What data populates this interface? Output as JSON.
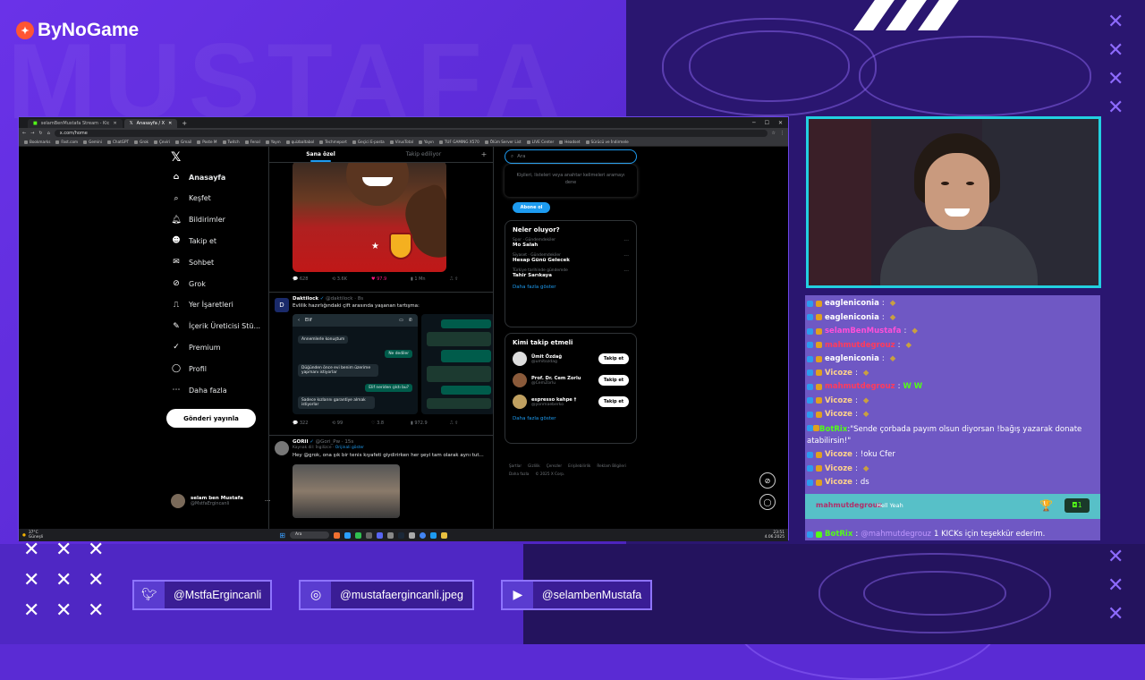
{
  "brand": {
    "logo": "ByNoGame"
  },
  "browser": {
    "tabs": [
      "selamBenMustafa Stream - Kic",
      "Anasayfa / X"
    ],
    "url": "x.com/home",
    "bookmarks": [
      "Bookmarks",
      "Fast.com",
      "Gemini",
      "ChatGPT",
      "Grok",
      "Çeviri",
      "Gmail",
      "Poste M",
      "Twitch",
      "Fenal",
      "Yayın",
      "quizbaltabol",
      "Techmeport",
      "Geçici E-posta",
      "VirusTotal",
      "Yayın",
      "TUF GAMING X570",
      "Ölüm Server List",
      "LIVE Center",
      "Headset",
      "Sürücü ve İndirmele"
    ]
  },
  "x": {
    "nav": [
      "Anasayfa",
      "Keşfet",
      "Bildirimler",
      "Takip et",
      "Sohbet",
      "Grok",
      "Yer İşaretleri",
      "İçerik Üreticisi Stü...",
      "Premium",
      "Profil",
      "Daha fazla"
    ],
    "post_button": "Gönderi yayınla",
    "me": {
      "name": "selam ben Mustafa",
      "handle": "@MstfaErgincanli"
    },
    "feed_tabs": [
      "Sana özel",
      "Takip ediliyor"
    ],
    "post1_actions": [
      "628",
      "3.6K",
      "97.9",
      "1 Mn"
    ],
    "post2": {
      "name": "Daktilock",
      "meta": "@daktilock · 8s",
      "text": "Evlilik hazırlığındaki çift arasında yaşanan tartışma:",
      "chat_contact": "Elif",
      "bubbles": [
        "Annemlerle konuştum",
        "Ne dediler",
        "Düğünden önce evi benim üzerime yapmanı istiyorlar",
        "Elif neriden çıktı bu?",
        "Sadece kızlarını garantiye almak istiyorlar"
      ],
      "actions": [
        "322",
        "99",
        "3.8",
        "972.9"
      ]
    },
    "post3": {
      "name": "GORII",
      "meta": "@Gori_Pw · 15s",
      "sub": "Kaynak dil: İngilizce",
      "sub_link": "Orijinali göster",
      "text": "Hey @grok, ona şık bir tenis kıyafeti giydirirken her şeyi tam olarak aynı tut..."
    },
    "search_placeholder": "Ara",
    "search_hint": "Kişileri, listeleri veya anahtar kelimeleri aramayı dene",
    "subscribe": "Abone ol",
    "trends_title": "Neler oluyor?",
    "trends": [
      {
        "cat": "Spor · Gündemdekiler",
        "title": "Mo Salah"
      },
      {
        "cat": "Siyaset · Gündemdekiler",
        "title": "Hesap Günü Gelecek"
      },
      {
        "cat": "Türkiye tarihinde gündemde",
        "title": "Tahir Sarıkaya"
      }
    ],
    "show_more": "Daha fazla göster",
    "who_title": "Kimi takip etmeli",
    "who": [
      {
        "name": "Ümit Özdağ",
        "handle": "@umitozdag"
      },
      {
        "name": "Prof. Dr. Cem Zorlu",
        "handle": "@CemZorlu"
      },
      {
        "name": "espresso kahpe †",
        "handle": "@yonmaeberko"
      }
    ],
    "follow": "Takip et",
    "footer": [
      "Şartlar",
      "Gizlilik",
      "Çerezler",
      "Erişilebilirlik",
      "Reklam Bilgileri",
      "Daha fazla",
      "© 2025 X Corp."
    ]
  },
  "taskbar": {
    "weather": "37°C",
    "weather_sub": "Güneşli",
    "search": "Ara",
    "time": "23:51",
    "date": "4.06.2025"
  },
  "chat": [
    {
      "name": "eagleniconia",
      "msg": ""
    },
    {
      "name": "eagleniconia",
      "msg": ""
    },
    {
      "name": "selamBenMustafa",
      "msg": ""
    },
    {
      "name": "mahmutdegrouz",
      "msg": ""
    },
    {
      "name": "eagleniconia",
      "msg": ""
    },
    {
      "name": "Vicoze",
      "msg": ""
    },
    {
      "name": "mahmutdegrouz",
      "msg": "W  W"
    },
    {
      "name": "Vicoze",
      "msg": ""
    },
    {
      "name": "Vicoze",
      "msg": ""
    },
    {
      "name": "BotRix",
      "msg": "\"Sende çorbada payım olsun diyorsan !bağış yazarak donate atabilirsin!\""
    },
    {
      "name": "Vicoze",
      "msg": "!oku Cfer"
    },
    {
      "name": "Vicoze",
      "msg": ""
    },
    {
      "name": "Vicoze",
      "msg": "ds"
    }
  ],
  "highlight": {
    "name": "mahmutdegrouz",
    "msg": "Hell Yeah",
    "count": "1"
  },
  "last_chat": {
    "name": "BotRix",
    "target": "@mahmutdegrouz",
    "msg": "1 KICKs için teşekkür ederim."
  },
  "socials": [
    {
      "icon": "twitter-icon",
      "handle": "@MstfaErgincanli"
    },
    {
      "icon": "instagram-icon",
      "handle": "@mustafaergincanli.jpeg"
    },
    {
      "icon": "youtube-icon",
      "handle": "@selambenMustafa"
    }
  ]
}
